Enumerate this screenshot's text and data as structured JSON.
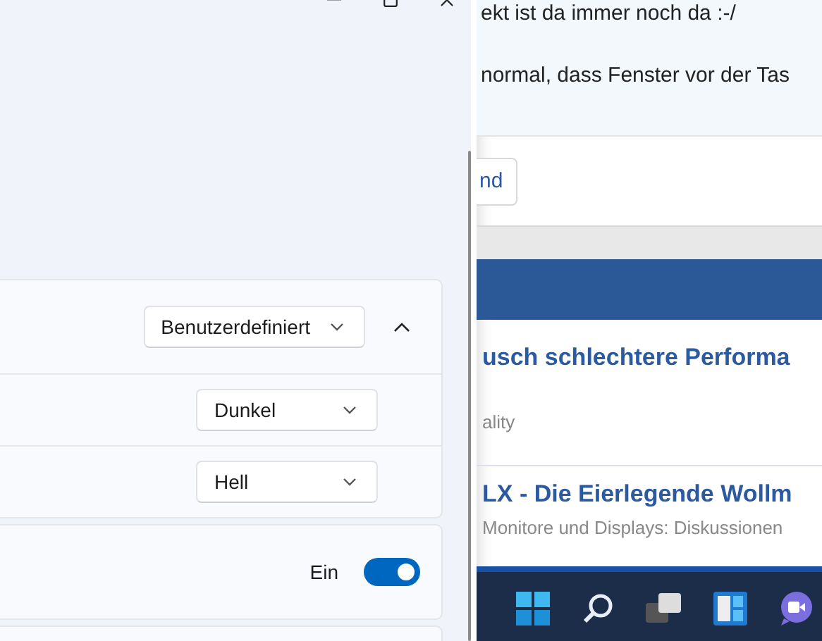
{
  "settings_window": {
    "rows": [
      {
        "kind": "dropdown",
        "value": "Benutzerdefiniert",
        "expanded": true
      },
      {
        "kind": "dropdown",
        "value": "Dunkel"
      },
      {
        "kind": "dropdown",
        "value": "Hell"
      }
    ],
    "toggle_row": {
      "label": "Ein",
      "on": true
    }
  },
  "browser": {
    "post_lines": [
      "ekt ist da immer noch da :-/",
      "normal, dass Fenster vor der Tas"
    ],
    "button": "nd",
    "threads": [
      {
        "title": "usch schlechtere Performa",
        "meta": "ality"
      },
      {
        "title": "LX - Die Eierlegende Wollm",
        "meta": "Monitore und Displays: Diskussionen"
      }
    ]
  }
}
